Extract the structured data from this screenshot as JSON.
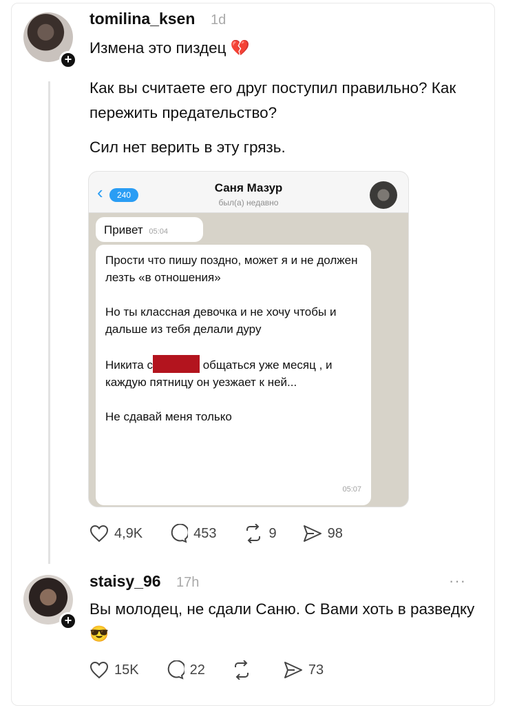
{
  "post": {
    "username": "tomilina_ksen",
    "time_ago": "1d",
    "headline": "Измена это пиздец 💔",
    "paragraph1": "Как вы считаете его друг поступил правильно? Как пережить предательство?",
    "paragraph2": "Сил нет верить в эту грязь.",
    "actions": {
      "likes": "4,9K",
      "comments": "453",
      "reposts": "9",
      "shares": "98"
    },
    "icons": [
      "heart-icon",
      "comment-icon",
      "repost-icon",
      "share-icon"
    ]
  },
  "chat": {
    "back_count": "240",
    "contact_name": "Саня Мазур",
    "contact_status": "был(а) недавно",
    "msg1_text": "Привет",
    "msg1_time": "05:04",
    "msg2_p1": "Прости что пишу поздно, может я и не должен лезть «в отношения»",
    "msg2_p2": "Но ты классная девочка и не хочу чтобы и дальше из тебя делали дуру",
    "msg2_p3_start": "Никита с",
    "msg2_p3_end": "общаться уже месяц , и каждую пятницу он уезжает к ней...",
    "msg2_p4": "Не сдавай меня только",
    "msg2_time": "05:07"
  },
  "reply": {
    "username": "staisy_96",
    "time_ago": "17h",
    "more": "···",
    "text": "Вы молодец, не сдали Саню. С Вами хоть в разведку 😎",
    "actions": {
      "likes": "15K",
      "comments": "22",
      "shares": "73"
    }
  }
}
